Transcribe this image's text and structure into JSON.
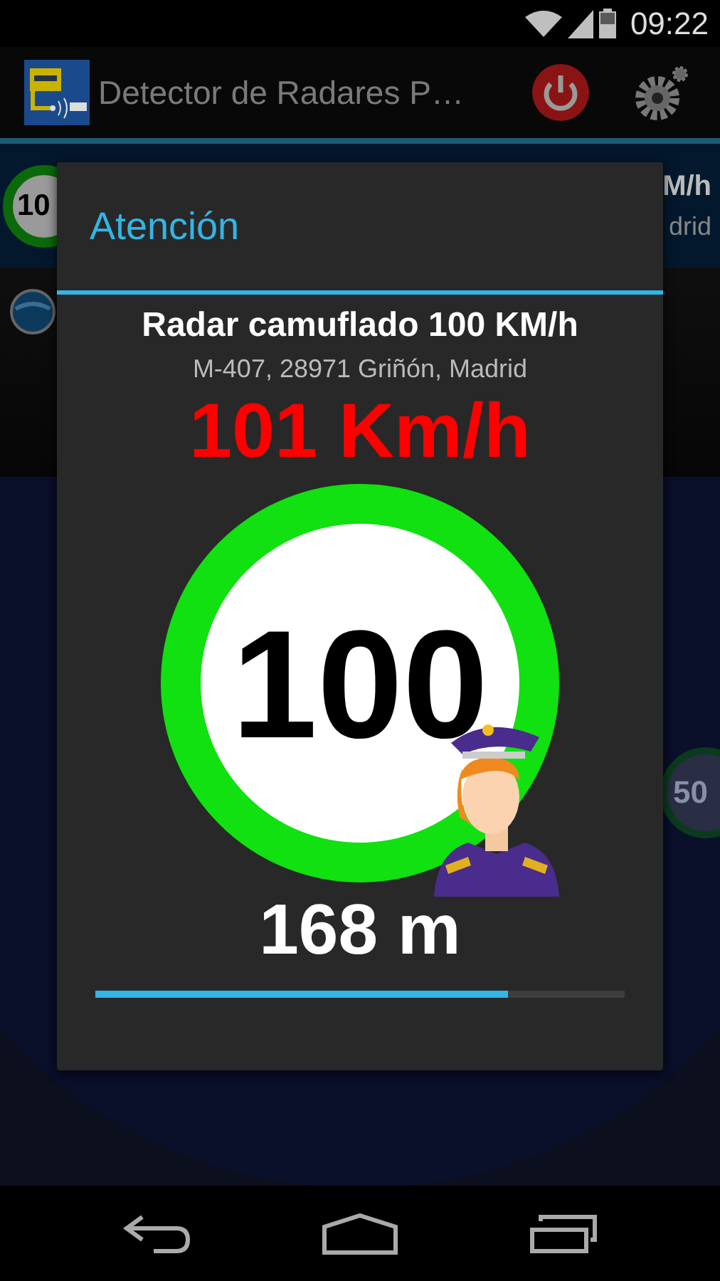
{
  "status_bar": {
    "time": "09:22"
  },
  "app_bar": {
    "title": "Detector de Radares P…"
  },
  "list_item": {
    "sign": "10",
    "title_fragment": "M/h",
    "subtitle_fragment": "drid"
  },
  "map": {
    "sign": "50"
  },
  "dialog": {
    "title": "Atención",
    "radar_name": "Radar camuflado 100 KM/h",
    "address": "M-407, 28971 Griñón, Madrid",
    "speed": "101 Km/h",
    "limit_sign": "100",
    "distance": "168 m",
    "progress": {
      "level": 0.78
    }
  }
}
